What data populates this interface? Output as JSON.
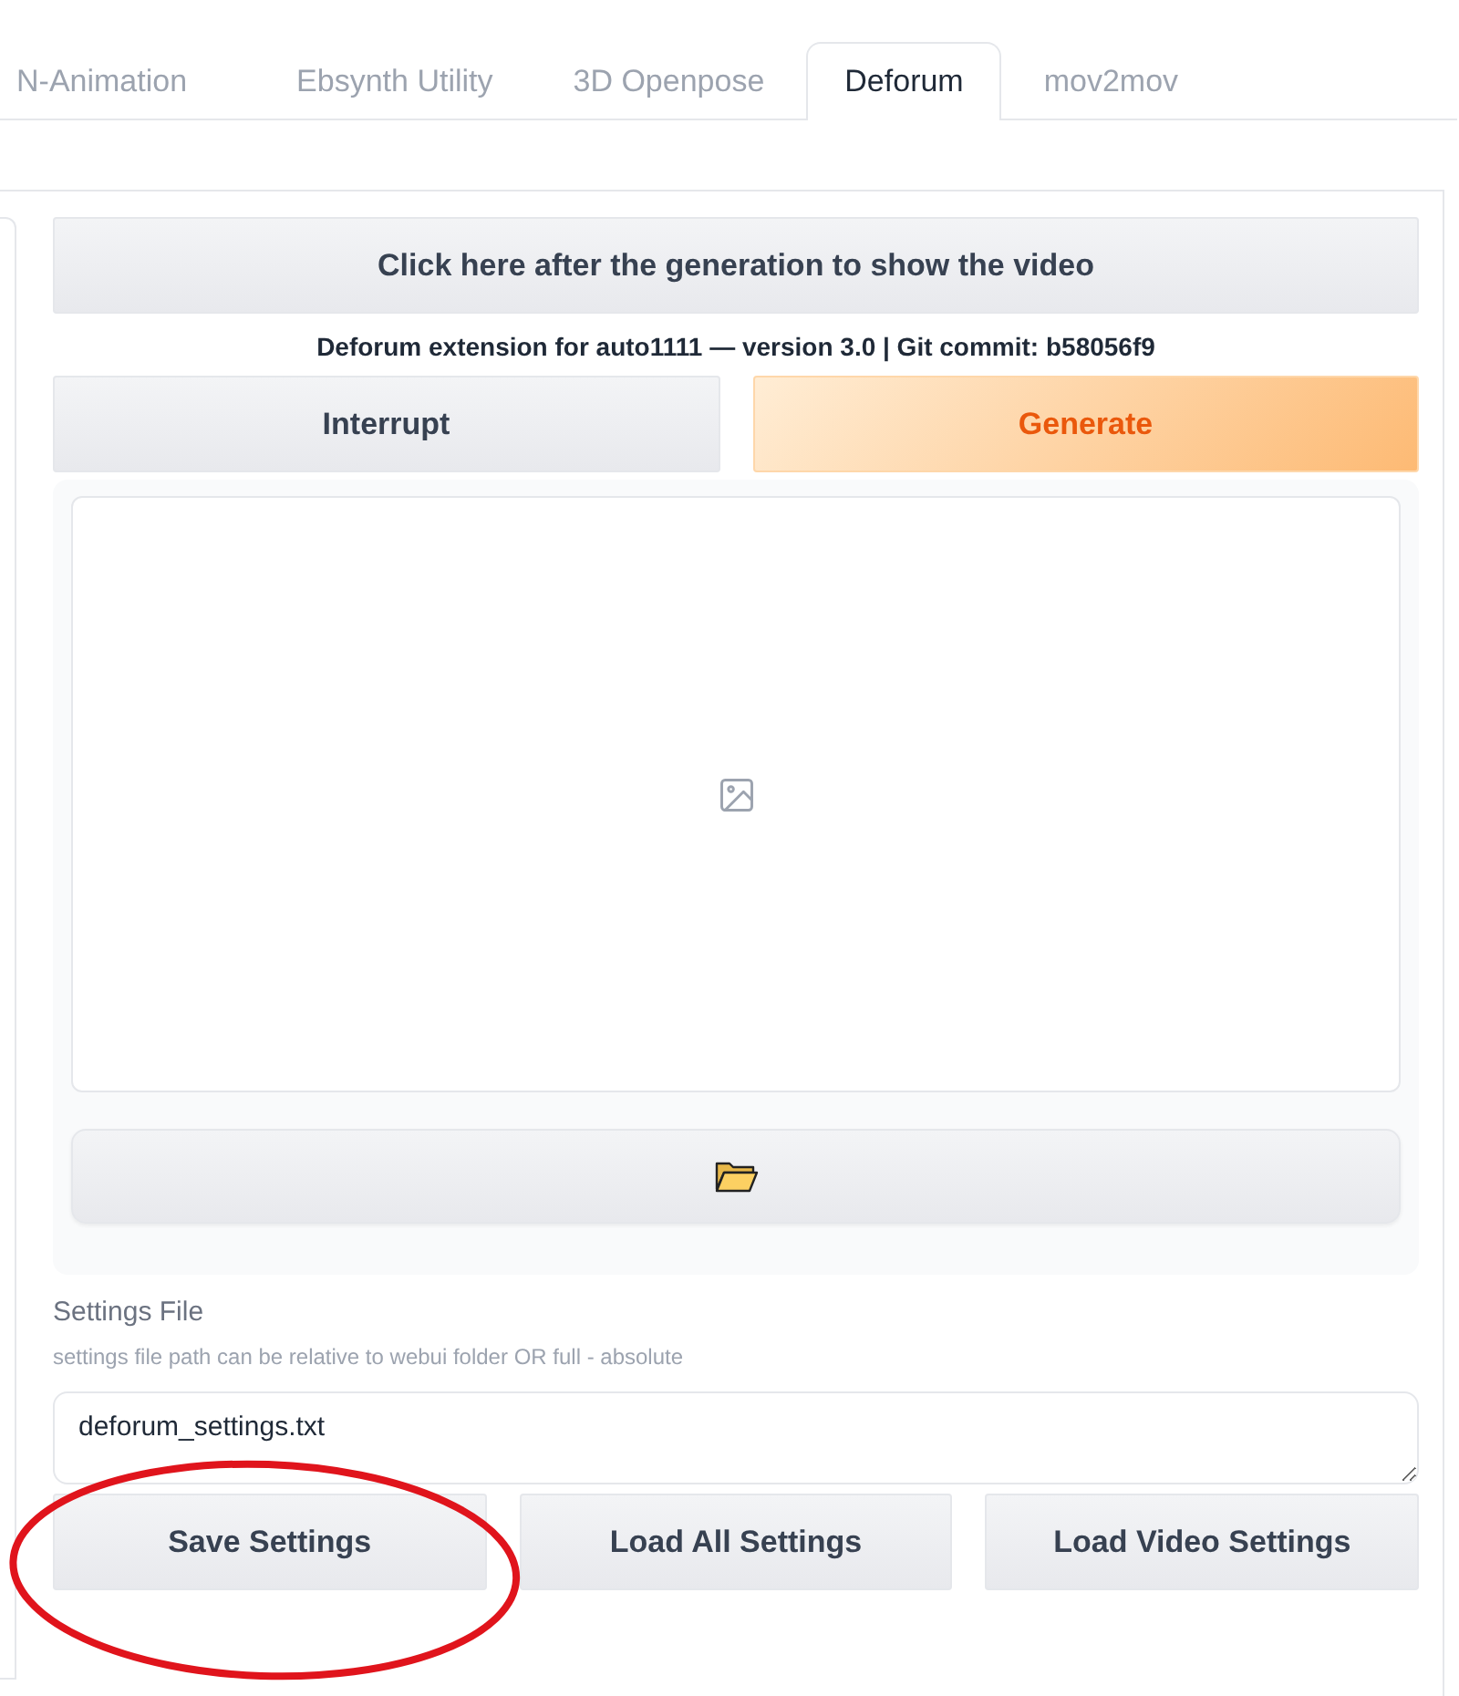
{
  "tabs": [
    {
      "label": "N-Animation",
      "selected": false
    },
    {
      "label": "Ebsynth Utility",
      "selected": false
    },
    {
      "label": "3D Openpose",
      "selected": false
    },
    {
      "label": "Deforum",
      "selected": true
    },
    {
      "label": "mov2mov",
      "selected": false
    }
  ],
  "show_video_button": "Click here after the generation to show the video",
  "version_text": "Deforum extension for auto1111 — version 3.0 | Git commit: b58056f9",
  "action_buttons": [
    {
      "label": "Interrupt",
      "kind": "secondary"
    },
    {
      "label": "Generate",
      "kind": "primary"
    }
  ],
  "settings_file": {
    "label": "Settings File",
    "info": "settings file path can be relative to webui folder OR full - absolute",
    "value": "deforum_settings.txt"
  },
  "settings_buttons": [
    "Save Settings",
    "Load All Settings",
    "Load Video Settings"
  ],
  "annotation": {
    "kind": "ellipse",
    "color": "#e0141c"
  }
}
